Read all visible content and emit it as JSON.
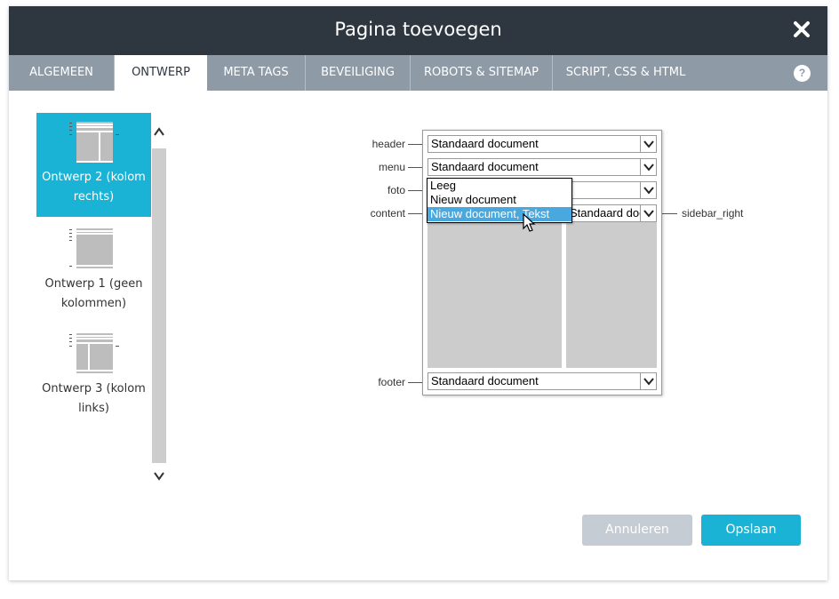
{
  "dialog": {
    "title": "Pagina toevoegen"
  },
  "tabs": [
    {
      "label": "ALGEMEEN",
      "active": false
    },
    {
      "label": "ONTWERP",
      "active": true
    },
    {
      "label": "META TAGS",
      "active": false
    },
    {
      "label": "BEVEILIGING",
      "active": false
    },
    {
      "label": "ROBOTS & SITEMAP",
      "active": false
    },
    {
      "label": "SCRIPT, CSS & HTML",
      "active": false
    }
  ],
  "help": {
    "glyph": "?"
  },
  "layouts": [
    {
      "label": "Ontwerp 2 (kolom rechts)",
      "selected": true
    },
    {
      "label": "Ontwerp 1 (geen kolommen)",
      "selected": false
    },
    {
      "label": "Ontwerp 3 (kolom links)",
      "selected": false
    }
  ],
  "regions": {
    "header": {
      "label": "header",
      "value": "Standaard document"
    },
    "menu": {
      "label": "menu",
      "value": "Standaard document"
    },
    "foto": {
      "label": "foto",
      "value": ""
    },
    "content": {
      "label": "content",
      "value": ""
    },
    "sidebar_right": {
      "label": "sidebar_right",
      "value": "Standaard document"
    },
    "footer": {
      "label": "footer",
      "value": "Standaard document"
    }
  },
  "dropdown": {
    "options": [
      "Leeg",
      "Nieuw document",
      "Nieuw document, Tekst"
    ],
    "highlighted": 2
  },
  "buttons": {
    "cancel": "Annuleren",
    "save": "Opslaan"
  },
  "colors": {
    "titlebar": "#2e3740",
    "tabbar": "#8e9ba6",
    "accent": "#1ab3d6",
    "cancel_button": "#c5ccd3",
    "dropdown_highlight": "#49a8de"
  },
  "icons": [
    "close-icon",
    "help-icon",
    "chevron-up-icon",
    "chevron-down-icon",
    "mouse-cursor-icon"
  ]
}
